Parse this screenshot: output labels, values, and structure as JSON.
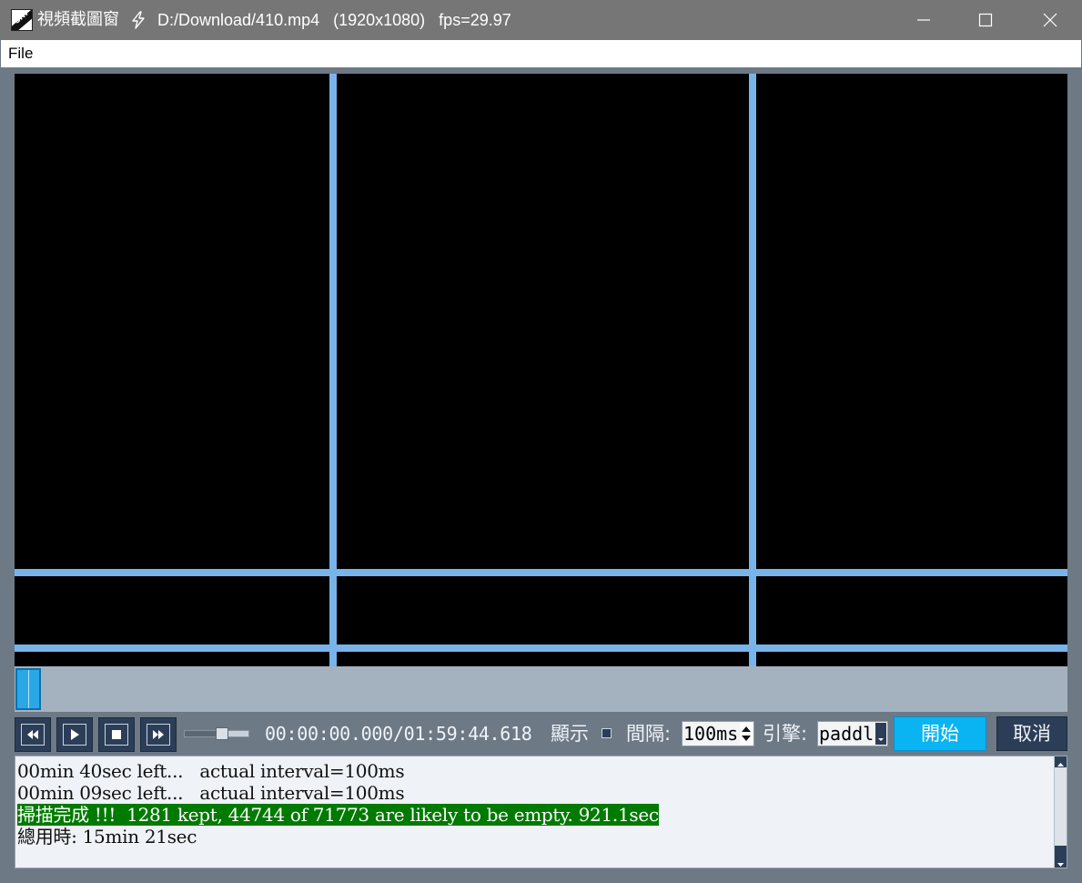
{
  "window": {
    "app_title": "視頻截圖窗",
    "file_info": "D:/Download/410.mp4   (1920x1080)   fps=29.97"
  },
  "menu": {
    "file_label": "File"
  },
  "seek": {
    "position_fraction": 0.0
  },
  "controls": {
    "timecode": "00:00:00.000/01:59:44.618",
    "show_label": "顯示",
    "show_checked": false,
    "interval_label": "間隔:",
    "interval_value": "100ms",
    "engine_label": "引擎:",
    "engine_value": "paddl",
    "start_label": "開始",
    "cancel_label": "取消",
    "volume_fraction": 0.6
  },
  "log": {
    "lines": [
      {
        "text": "00min 40sec left...   actual interval=100ms",
        "highlight": false
      },
      {
        "text": "00min 09sec left...   actual interval=100ms",
        "highlight": false
      },
      {
        "text": "掃描完成 !!!  1281 kept, 44744 of 71773 are likely to be empty. 921.1sec",
        "highlight": true
      },
      {
        "text": "總用時: 15min 21sec",
        "highlight": false
      }
    ]
  },
  "colors": {
    "accent": "#0ab4f2",
    "guide_lines": "#78b4ea",
    "highlight_bg": "#007a00"
  },
  "icons": {
    "app": "app-icon",
    "title_bolt": "bolt-icon",
    "rewind": "rewind-icon",
    "play": "play-icon",
    "stop": "stop-icon",
    "fast_forward": "fast-forward-icon"
  }
}
